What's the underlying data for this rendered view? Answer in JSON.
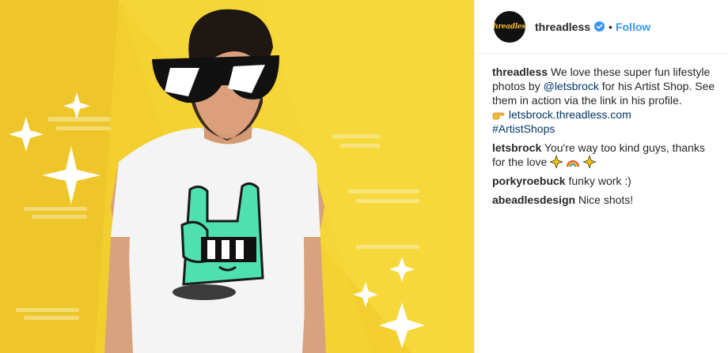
{
  "header": {
    "avatar_text": "threadless",
    "username": "threadless",
    "verified": true,
    "separator": "•",
    "follow_label": "Follow"
  },
  "caption": {
    "username": "threadless",
    "text_part1": "We love these super fun lifestyle photos by",
    "mention": "@letsbrock",
    "text_part2": "for his Artist Shop. See them in action via the link in his profile.",
    "link_emoji": "pointing-hand-icon",
    "link": "letsbrock.threadless.com",
    "hashtag": "#ArtistShops"
  },
  "comments": [
    {
      "username": "letsbrock",
      "text": "You're way too kind guys, thanks for the love",
      "emojis": [
        "sparkle-icon",
        "rainbow-icon",
        "sparkle-icon"
      ]
    },
    {
      "username": "porkyroebuck",
      "text": "funky work :)"
    },
    {
      "username": "abeadlesdesign",
      "text": "Nice shots!"
    }
  ],
  "colors": {
    "background_yellow": "#f2cf2e",
    "shirt": "#f4f4f4",
    "hand_green": "#4fe0b0",
    "link_blue": "#003569",
    "follow_blue": "#3897f0"
  }
}
